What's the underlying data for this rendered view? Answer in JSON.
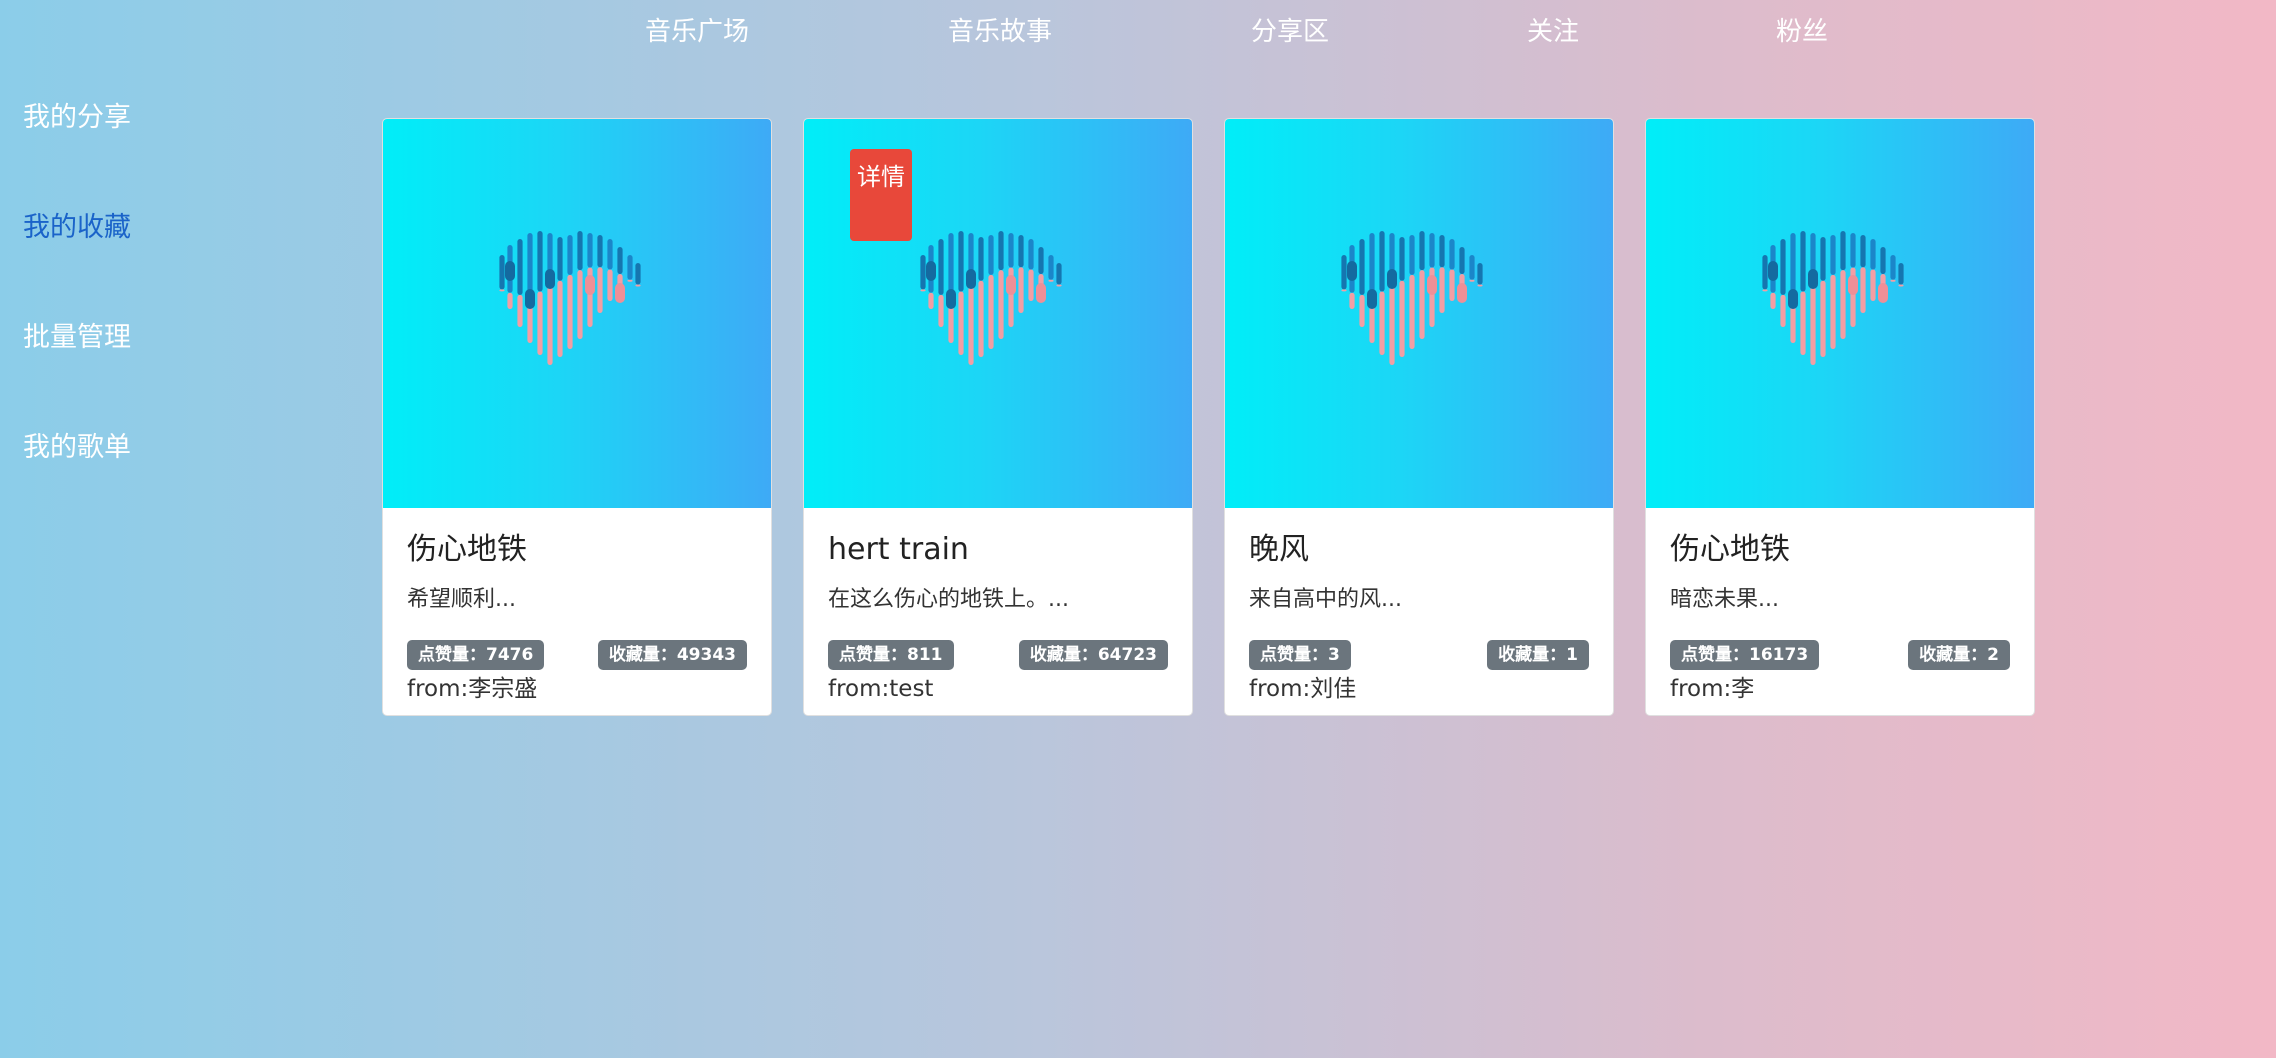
{
  "top_nav": [
    {
      "label": "音乐广场"
    },
    {
      "label": "音乐故事"
    },
    {
      "label": "分享区"
    },
    {
      "label": "关注"
    },
    {
      "label": "粉丝"
    }
  ],
  "sidebar": {
    "items": [
      {
        "label": "我的分享",
        "active": false
      },
      {
        "label": "我的收藏",
        "active": true
      },
      {
        "label": "批量管理",
        "active": false
      },
      {
        "label": "我的歌单",
        "active": false
      }
    ]
  },
  "cards": [
    {
      "title": "伤心地铁",
      "desc": "希望顺利...",
      "likes": "点赞量：7476",
      "favorites": "收藏量：49343",
      "from": "from:李宗盛",
      "badge": ""
    },
    {
      "title": "hert train",
      "desc": "在这么伤心的地铁上。...",
      "likes": "点赞量：811",
      "favorites": "收藏量：64723",
      "from": "from:test",
      "badge": "详情"
    },
    {
      "title": "晚风",
      "desc": "来自高中的风...",
      "likes": "点赞量：3",
      "favorites": "收藏量：1",
      "from": "from:刘佳",
      "badge": ""
    },
    {
      "title": "伤心地铁",
      "desc": "暗恋未果...",
      "likes": "点赞量：16173",
      "favorites": "收藏量：2",
      "from": "from:李",
      "badge": ""
    }
  ],
  "colors": {
    "active_sidebar": "#1a63c9",
    "detail_badge": "#e8483a",
    "stat_badge": "#6b757d",
    "cover_gradient_start": "#00eef8",
    "cover_gradient_end": "#3eaaf6"
  },
  "icons": {
    "cover": "sound-wave-heart-icon"
  }
}
